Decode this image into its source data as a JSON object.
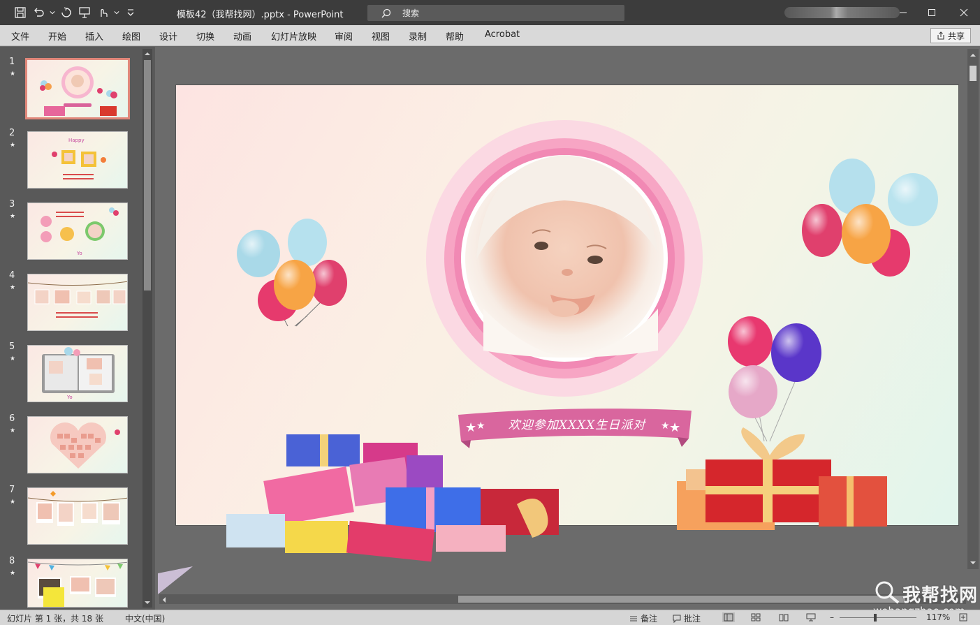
{
  "window": {
    "title": "模板42（我帮找网）.pptx  -  PowerPoint",
    "search_placeholder": "搜索"
  },
  "ribbon_tabs": [
    "文件",
    "开始",
    "插入",
    "绘图",
    "设计",
    "切换",
    "动画",
    "幻灯片放映",
    "审阅",
    "视图",
    "录制",
    "帮助",
    "Acrobat"
  ],
  "share_label": "共享",
  "thumbnails": [
    {
      "number": "1",
      "star": "★",
      "selected": true
    },
    {
      "number": "2",
      "star": "★",
      "selected": false
    },
    {
      "number": "3",
      "star": "★",
      "selected": false
    },
    {
      "number": "4",
      "star": "★",
      "selected": false
    },
    {
      "number": "5",
      "star": "★",
      "selected": false
    },
    {
      "number": "6",
      "star": "★",
      "selected": false
    },
    {
      "number": "7",
      "star": "★",
      "selected": false
    },
    {
      "number": "8",
      "star": "★",
      "selected": false
    }
  ],
  "slide": {
    "banner_text": "欢迎参加XXXX生日派对"
  },
  "status": {
    "slide_info": "幻灯片 第 1 张，共 18 张",
    "language": "中文(中国)",
    "notes": "备注",
    "comments": "批注",
    "zoom": "117%"
  },
  "watermark": {
    "name": "我帮找网",
    "url": "wobangzhao.com"
  }
}
